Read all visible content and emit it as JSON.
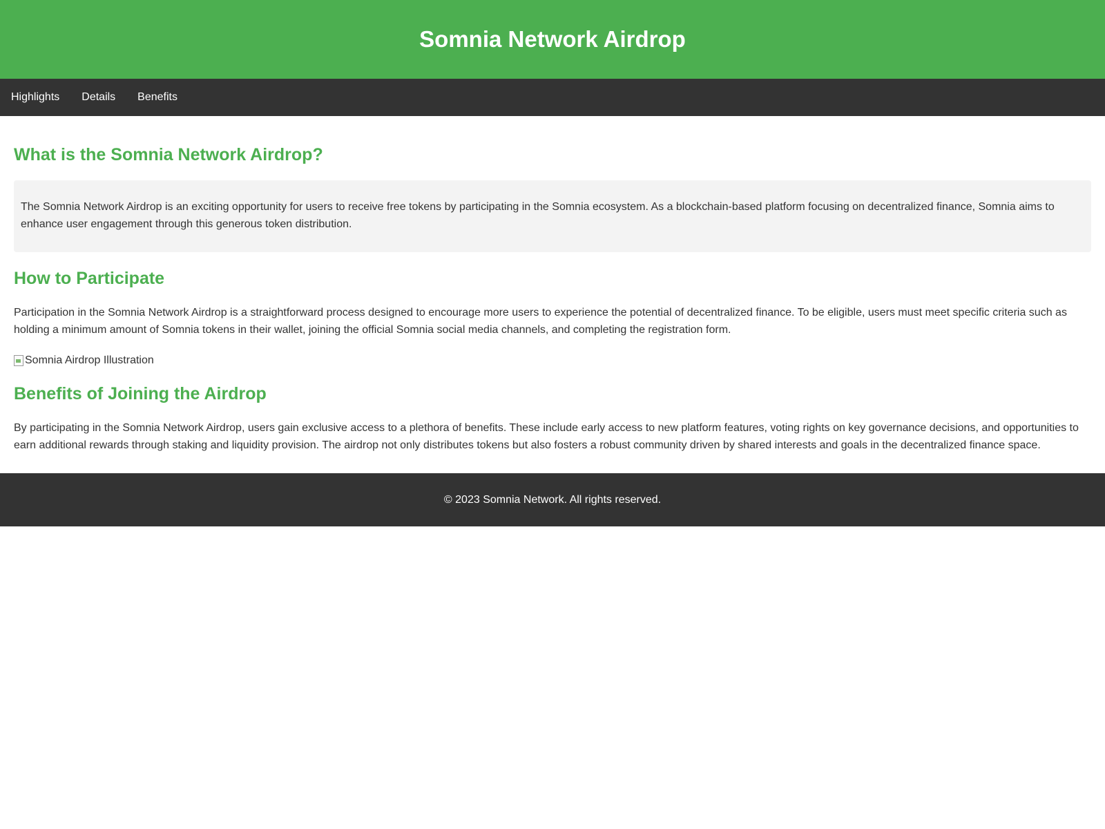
{
  "header": {
    "title": "Somnia Network Airdrop"
  },
  "nav": {
    "items": [
      {
        "label": "Highlights"
      },
      {
        "label": "Details"
      },
      {
        "label": "Benefits"
      }
    ]
  },
  "sections": {
    "what_is": {
      "heading": "What is the Somnia Network Airdrop?",
      "text": "The Somnia Network Airdrop is an exciting opportunity for users to receive free tokens by participating in the Somnia ecosystem. As a blockchain-based platform focusing on decentralized finance, Somnia aims to enhance user engagement through this generous token distribution."
    },
    "how_to": {
      "heading": "How to Participate",
      "text": "Participation in the Somnia Network Airdrop is a straightforward process designed to encourage more users to experience the potential of decentralized finance. To be eligible, users must meet specific criteria such as holding a minimum amount of Somnia tokens in their wallet, joining the official Somnia social media channels, and completing the registration form.",
      "image_alt": "Somnia Airdrop Illustration"
    },
    "benefits": {
      "heading": "Benefits of Joining the Airdrop",
      "text": "By participating in the Somnia Network Airdrop, users gain exclusive access to a plethora of benefits. These include early access to new platform features, voting rights on key governance decisions, and opportunities to earn additional rewards through staking and liquidity provision. The airdrop not only distributes tokens but also fosters a robust community driven by shared interests and goals in the decentralized finance space."
    }
  },
  "footer": {
    "text": "© 2023 Somnia Network. All rights reserved."
  },
  "colors": {
    "brand_green": "#4caf50",
    "dark_bar": "#333333",
    "box_background": "#f3f3f3"
  }
}
